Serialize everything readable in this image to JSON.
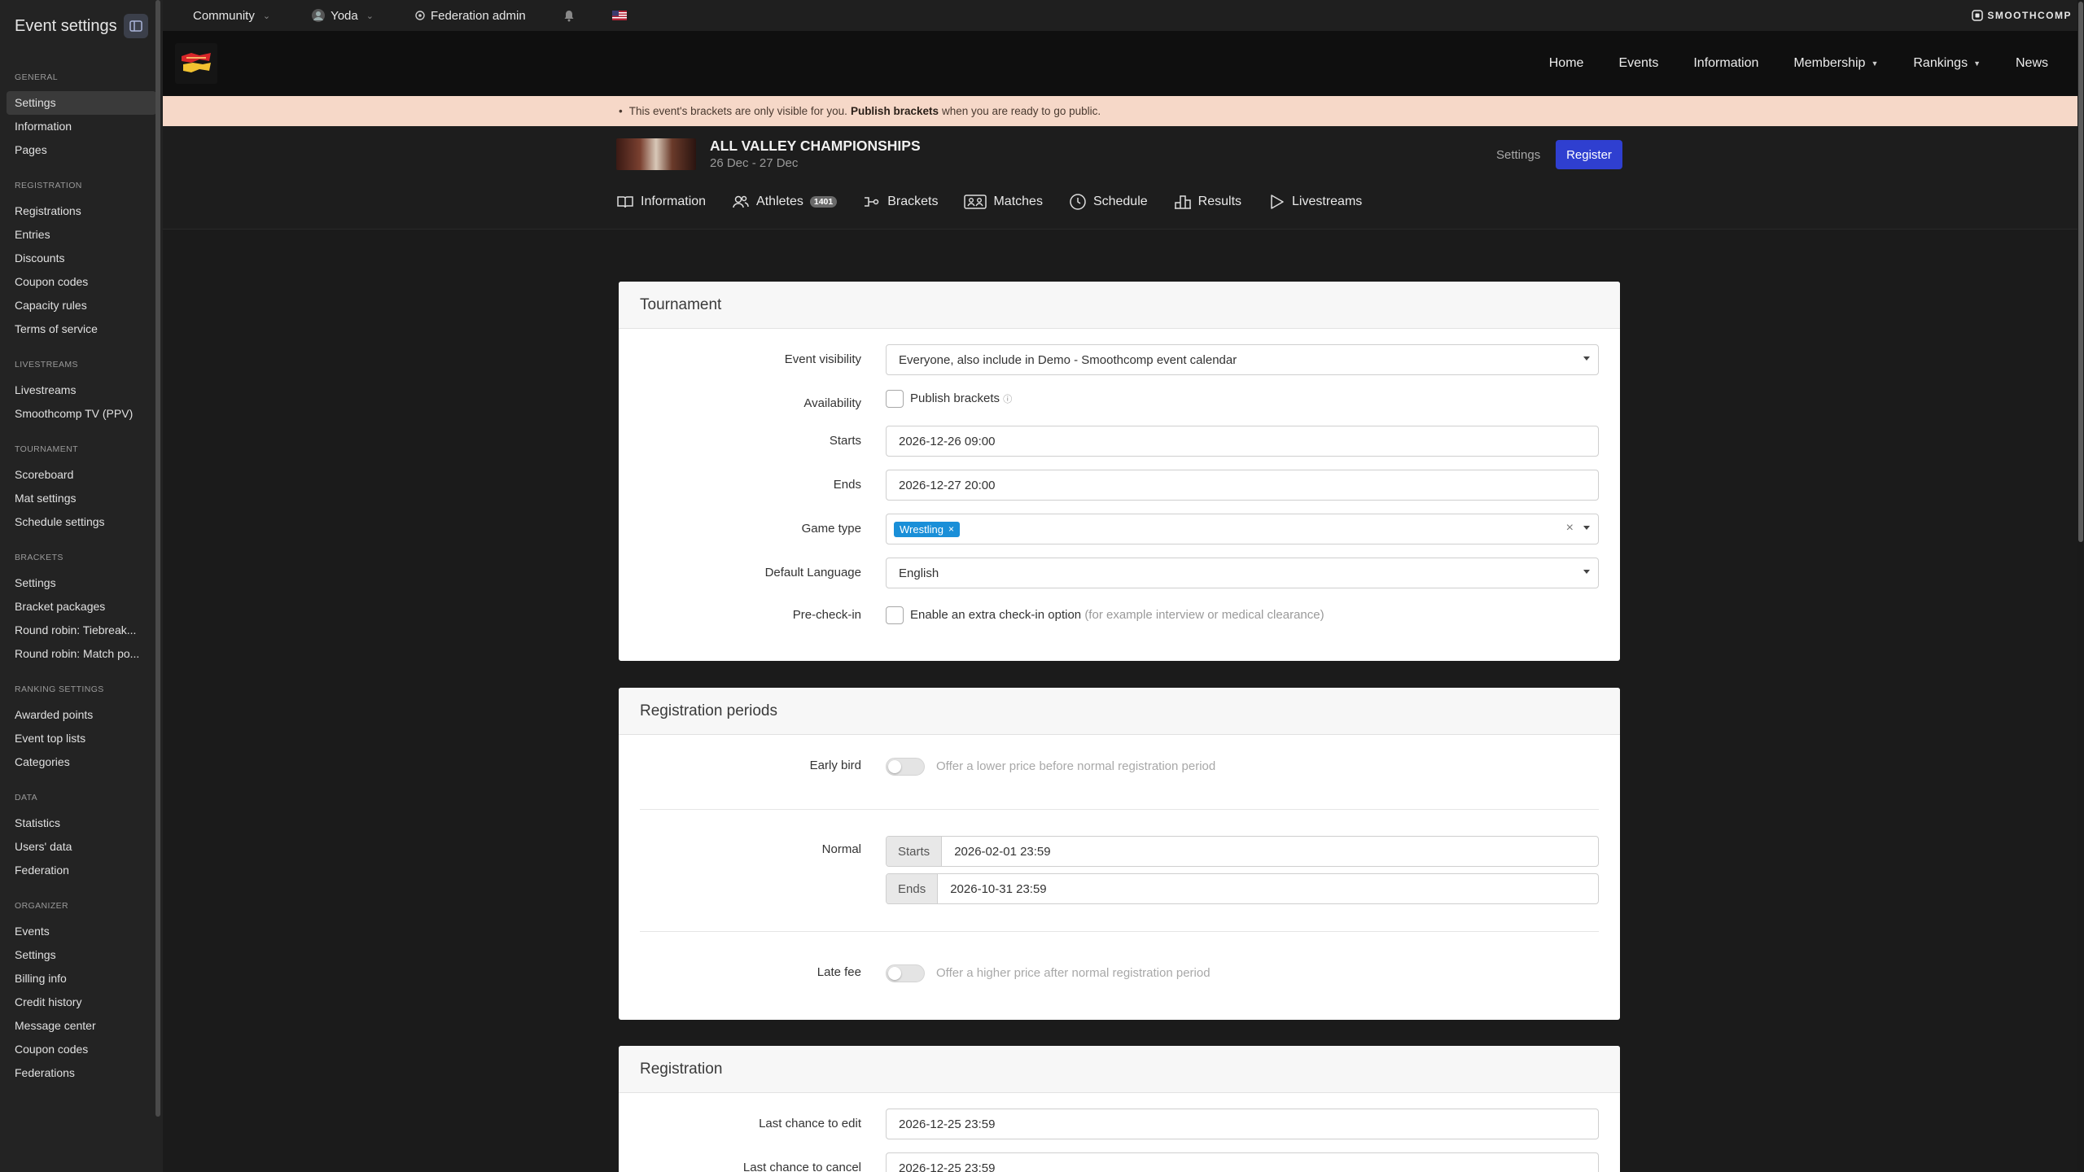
{
  "sidebar": {
    "title": "Event settings",
    "sections": [
      {
        "heading": "GENERAL",
        "items": [
          {
            "label": "Settings",
            "active": true
          },
          {
            "label": "Information"
          },
          {
            "label": "Pages"
          }
        ]
      },
      {
        "heading": "REGISTRATION",
        "items": [
          {
            "label": "Registrations"
          },
          {
            "label": "Entries"
          },
          {
            "label": "Discounts"
          },
          {
            "label": "Coupon codes"
          },
          {
            "label": "Capacity rules"
          },
          {
            "label": "Terms of service"
          }
        ]
      },
      {
        "heading": "LIVESTREAMS",
        "items": [
          {
            "label": "Livestreams"
          },
          {
            "label": "Smoothcomp TV (PPV)"
          }
        ]
      },
      {
        "heading": "TOURNAMENT",
        "items": [
          {
            "label": "Scoreboard"
          },
          {
            "label": "Mat settings"
          },
          {
            "label": "Schedule settings"
          }
        ]
      },
      {
        "heading": "BRACKETS",
        "items": [
          {
            "label": "Settings"
          },
          {
            "label": "Bracket packages"
          },
          {
            "label": "Round robin: Tiebreak..."
          },
          {
            "label": "Round robin: Match po..."
          }
        ]
      },
      {
        "heading": "RANKING SETTINGS",
        "items": [
          {
            "label": "Awarded points"
          },
          {
            "label": "Event top lists"
          },
          {
            "label": "Categories"
          }
        ]
      },
      {
        "heading": "DATA",
        "items": [
          {
            "label": "Statistics"
          },
          {
            "label": "Users' data"
          },
          {
            "label": "Federation"
          }
        ]
      },
      {
        "heading": "ORGANIZER",
        "items": [
          {
            "label": "Events"
          },
          {
            "label": "Settings"
          },
          {
            "label": "Billing info"
          },
          {
            "label": "Credit history"
          },
          {
            "label": "Message center"
          },
          {
            "label": "Coupon codes"
          },
          {
            "label": "Federations"
          }
        ]
      }
    ]
  },
  "topbar": {
    "community": "Community",
    "user": "Yoda",
    "admin": "Federation admin",
    "brand": "SMOOTHCOMP"
  },
  "nav": {
    "links": [
      "Home",
      "Events",
      "Information",
      "Membership",
      "Rankings",
      "News"
    ]
  },
  "notice": {
    "text_before": "This event's brackets are only visible for you.",
    "bold": "Publish brackets",
    "text_after": "when you are ready to go public."
  },
  "event": {
    "title": "ALL VALLEY CHAMPIONSHIPS",
    "dates": "26 Dec - 27 Dec",
    "settings_link": "Settings",
    "register": "Register",
    "tabs": {
      "information": "Information",
      "athletes": "Athletes",
      "athletes_count": "1401",
      "brackets": "Brackets",
      "matches": "Matches",
      "schedule": "Schedule",
      "results": "Results",
      "livestreams": "Livestreams"
    }
  },
  "tournament": {
    "title": "Tournament",
    "visibility_label": "Event visibility",
    "visibility_value": "Everyone, also include in Demo - Smoothcomp event calendar",
    "availability_label": "Availability",
    "publish_label": "Publish brackets",
    "starts_label": "Starts",
    "starts_value": "2026-12-26 09:00",
    "ends_label": "Ends",
    "ends_value": "2026-12-27 20:00",
    "game_type_label": "Game type",
    "game_type_tag": "Wrestling",
    "language_label": "Default Language",
    "language_value": "English",
    "precheck_label": "Pre-check-in",
    "precheck_option": "Enable an extra check-in option",
    "precheck_hint": "(for example interview or medical clearance)"
  },
  "registration_periods": {
    "title": "Registration periods",
    "early_label": "Early bird",
    "early_hint": "Offer a lower price before normal registration period",
    "normal_label": "Normal",
    "starts_addon": "Starts",
    "starts_value": "2026-02-01 23:59",
    "ends_addon": "Ends",
    "ends_value": "2026-10-31 23:59",
    "late_label": "Late fee",
    "late_hint": "Offer a higher price after normal registration period"
  },
  "registration": {
    "title": "Registration",
    "last_edit_label": "Last chance to edit",
    "last_edit_value": "2026-12-25 23:59",
    "last_cancel_label": "Last chance to cancel",
    "last_cancel_value": "2026-12-25 23:59"
  }
}
